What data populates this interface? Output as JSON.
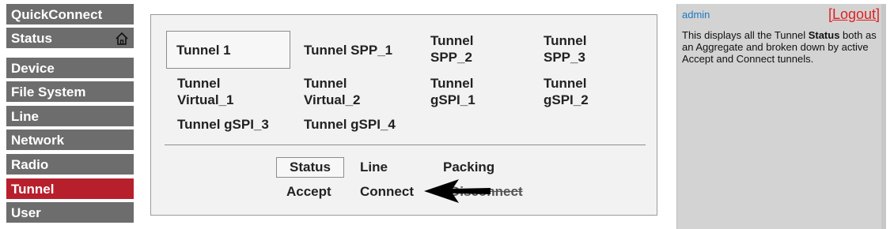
{
  "sidebar": {
    "items": [
      {
        "label": "QuickConnect"
      },
      {
        "label": "Status"
      },
      {
        "label": "Device"
      },
      {
        "label": "File System"
      },
      {
        "label": "Line"
      },
      {
        "label": "Network"
      },
      {
        "label": "Radio"
      },
      {
        "label": "Tunnel"
      },
      {
        "label": "User"
      }
    ],
    "active_item": "Tunnel",
    "active_color": "#b81f2c",
    "item_color": "#6d6d6d",
    "status_icon": "home-icon"
  },
  "tunnel_tabs": [
    {
      "label": "Tunnel 1",
      "selected": true
    },
    {
      "label": "Tunnel SPP_1"
    },
    {
      "line1": "Tunnel",
      "line2": "SPP_2"
    },
    {
      "line1": "Tunnel",
      "line2": "SPP_3"
    },
    {
      "line1": "Tunnel",
      "line2": "Virtual_1"
    },
    {
      "line1": "Tunnel",
      "line2": "Virtual_2"
    },
    {
      "line1": "Tunnel",
      "line2": "gSPI_1"
    },
    {
      "line1": "Tunnel",
      "line2": "gSPI_2"
    },
    {
      "label": "Tunnel gSPI_3"
    },
    {
      "label": "Tunnel gSPI_4"
    }
  ],
  "sub_tabs": [
    {
      "label": "Status",
      "selected": true
    },
    {
      "label": "Line"
    },
    {
      "label": "Packing"
    },
    {
      "label": "Accept"
    },
    {
      "label": "Connect"
    },
    {
      "label": "Disconnect",
      "struck": true
    }
  ],
  "annotation": {
    "icon": "arrow-left-icon",
    "points_to": "Connect"
  },
  "help": {
    "user": "admin",
    "logout": "[Logout]",
    "text_before": "This displays all the Tunnel ",
    "text_bold": "Status",
    "text_after": " both as an Aggregate and broken down by active Accept and Connect tunnels."
  }
}
